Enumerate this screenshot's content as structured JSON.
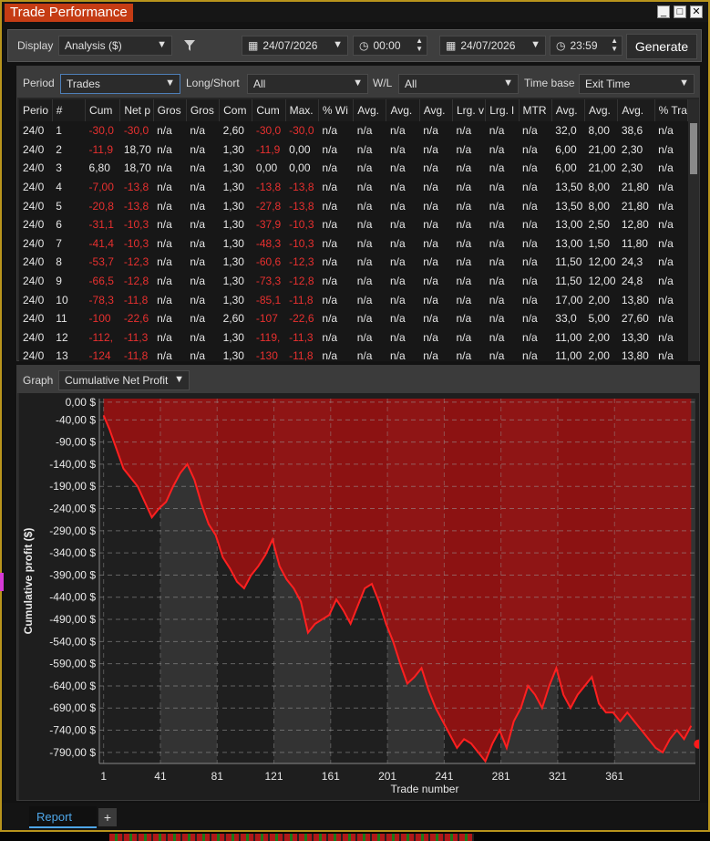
{
  "window": {
    "title": "Trade Performance",
    "controls": [
      "_",
      "□",
      "✕"
    ]
  },
  "toolbar": {
    "display_label": "Display",
    "display_value": "Analysis ($)",
    "start_date": "24/07/2026",
    "start_time": "00:00",
    "end_date": "24/07/2026",
    "end_time": "23:59",
    "generate_label": "Generate"
  },
  "filters": {
    "period_label": "Period",
    "period_value": "Trades",
    "longshort_label": "Long/Short",
    "longshort_value": "All",
    "wl_label": "W/L",
    "wl_value": "All",
    "timebase_label": "Time base",
    "timebase_value": "Exit Time"
  },
  "table": {
    "columns": [
      "Perio",
      "#",
      "Cum",
      "Net p",
      "Gros",
      "Gros",
      "Com",
      "Cum",
      "Max.",
      "% Wi",
      "Avg.",
      "Avg.",
      "Avg.",
      "Lrg. v",
      "Lrg. l",
      "MTR",
      "Avg.",
      "Avg.",
      "Avg.",
      "% Tra"
    ],
    "rows": [
      [
        "24/0",
        "1",
        "-30,0",
        "-30,0",
        "n/a",
        "n/a",
        "2,60",
        "-30,0",
        "-30,0",
        "n/a",
        "n/a",
        "n/a",
        "n/a",
        "n/a",
        "n/a",
        "n/a",
        "32,0",
        "8,00",
        "38,6",
        "n/a"
      ],
      [
        "24/0",
        "2",
        "-11,9",
        "18,70",
        "n/a",
        "n/a",
        "1,30",
        "-11,9",
        "0,00",
        "n/a",
        "n/a",
        "n/a",
        "n/a",
        "n/a",
        "n/a",
        "n/a",
        "6,00",
        "21,00",
        "2,30",
        "n/a"
      ],
      [
        "24/0",
        "3",
        "6,80",
        "18,70",
        "n/a",
        "n/a",
        "1,30",
        "0,00",
        "0,00",
        "n/a",
        "n/a",
        "n/a",
        "n/a",
        "n/a",
        "n/a",
        "n/a",
        "6,00",
        "21,00",
        "2,30",
        "n/a"
      ],
      [
        "24/0",
        "4",
        "-7,00",
        "-13,8",
        "n/a",
        "n/a",
        "1,30",
        "-13,8",
        "-13,8",
        "n/a",
        "n/a",
        "n/a",
        "n/a",
        "n/a",
        "n/a",
        "n/a",
        "13,50",
        "8,00",
        "21,80",
        "n/a"
      ],
      [
        "24/0",
        "5",
        "-20,8",
        "-13,8",
        "n/a",
        "n/a",
        "1,30",
        "-27,8",
        "-13,8",
        "n/a",
        "n/a",
        "n/a",
        "n/a",
        "n/a",
        "n/a",
        "n/a",
        "13,50",
        "8,00",
        "21,80",
        "n/a"
      ],
      [
        "24/0",
        "6",
        "-31,1",
        "-10,3",
        "n/a",
        "n/a",
        "1,30",
        "-37,9",
        "-10,3",
        "n/a",
        "n/a",
        "n/a",
        "n/a",
        "n/a",
        "n/a",
        "n/a",
        "13,00",
        "2,50",
        "12,80",
        "n/a"
      ],
      [
        "24/0",
        "7",
        "-41,4",
        "-10,3",
        "n/a",
        "n/a",
        "1,30",
        "-48,3",
        "-10,3",
        "n/a",
        "n/a",
        "n/a",
        "n/a",
        "n/a",
        "n/a",
        "n/a",
        "13,00",
        "1,50",
        "11,80",
        "n/a"
      ],
      [
        "24/0",
        "8",
        "-53,7",
        "-12,3",
        "n/a",
        "n/a",
        "1,30",
        "-60,6",
        "-12,3",
        "n/a",
        "n/a",
        "n/a",
        "n/a",
        "n/a",
        "n/a",
        "n/a",
        "11,50",
        "12,00",
        "24,3",
        "n/a"
      ],
      [
        "24/0",
        "9",
        "-66,5",
        "-12,8",
        "n/a",
        "n/a",
        "1,30",
        "-73,3",
        "-12,8",
        "n/a",
        "n/a",
        "n/a",
        "n/a",
        "n/a",
        "n/a",
        "n/a",
        "11,50",
        "12,00",
        "24,8",
        "n/a"
      ],
      [
        "24/0",
        "10",
        "-78,3",
        "-11,8",
        "n/a",
        "n/a",
        "1,30",
        "-85,1",
        "-11,8",
        "n/a",
        "n/a",
        "n/a",
        "n/a",
        "n/a",
        "n/a",
        "n/a",
        "17,00",
        "2,00",
        "13,80",
        "n/a"
      ],
      [
        "24/0",
        "11",
        "-100",
        "-22,6",
        "n/a",
        "n/a",
        "2,60",
        "-107",
        "-22,6",
        "n/a",
        "n/a",
        "n/a",
        "n/a",
        "n/a",
        "n/a",
        "n/a",
        "33,0",
        "5,00",
        "27,60",
        "n/a"
      ],
      [
        "24/0",
        "12",
        "-112,",
        "-11,3",
        "n/a",
        "n/a",
        "1,30",
        "-119,",
        "-11,3",
        "n/a",
        "n/a",
        "n/a",
        "n/a",
        "n/a",
        "n/a",
        "n/a",
        "11,00",
        "2,00",
        "13,30",
        "n/a"
      ],
      [
        "24/0",
        "13",
        "-124",
        "-11,8",
        "n/a",
        "n/a",
        "1,30",
        "-130",
        "-11,8",
        "n/a",
        "n/a",
        "n/a",
        "n/a",
        "n/a",
        "n/a",
        "n/a",
        "11,00",
        "2,00",
        "13,80",
        "n/a"
      ]
    ]
  },
  "graph": {
    "label": "Graph",
    "value": "Cumulative Net Profit"
  },
  "chart_data": {
    "type": "area",
    "title": "",
    "xlabel": "Trade number",
    "ylabel": "Cumulative profit ($)",
    "xticks": [
      1,
      41,
      81,
      121,
      161,
      201,
      241,
      281,
      321,
      361
    ],
    "ytick_labels": [
      "0,00 $",
      "-40,00 $",
      "-90,00 $",
      "-140,00 $",
      "-190,00 $",
      "-240,00 $",
      "-290,00 $",
      "-340,00 $",
      "-390,00 $",
      "-440,00 $",
      "-490,00 $",
      "-540,00 $",
      "-590,00 $",
      "-640,00 $",
      "-690,00 $",
      "-740,00 $",
      "-790,00 $"
    ],
    "ytick_values": [
      0,
      -40,
      -90,
      -140,
      -190,
      -240,
      -290,
      -340,
      -390,
      -440,
      -490,
      -540,
      -590,
      -640,
      -690,
      -740,
      -790
    ],
    "xlim": [
      -2,
      418
    ],
    "ylim": [
      -815,
      8
    ],
    "series": [
      {
        "x": [
          1,
          5,
          10,
          15,
          20,
          25,
          30,
          35,
          40,
          45,
          50,
          55,
          60,
          65,
          70,
          75,
          80,
          85,
          90,
          95,
          100,
          105,
          110,
          115,
          120,
          125,
          130,
          135,
          140,
          145,
          150,
          155,
          160,
          165,
          170,
          175,
          180,
          185,
          190,
          195,
          200,
          205,
          210,
          215,
          220,
          225,
          230,
          235,
          240,
          245,
          250,
          255,
          260,
          265,
          270,
          275,
          280,
          285,
          290,
          295,
          300,
          305,
          310,
          315,
          320,
          325,
          330,
          335,
          340,
          345,
          350,
          355,
          360,
          365,
          370,
          375,
          380,
          385,
          390,
          395,
          400,
          405,
          410,
          415
        ],
        "y": [
          -30,
          -60,
          -105,
          -150,
          -170,
          -190,
          -225,
          -260,
          -240,
          -225,
          -190,
          -160,
          -140,
          -175,
          -230,
          -275,
          -300,
          -350,
          -375,
          -405,
          -420,
          -390,
          -370,
          -345,
          -310,
          -370,
          -400,
          -420,
          -450,
          -520,
          -500,
          -490,
          -480,
          -445,
          -470,
          -500,
          -460,
          -420,
          -410,
          -450,
          -500,
          -540,
          -590,
          -635,
          -620,
          -600,
          -650,
          -690,
          -720,
          -750,
          -780,
          -760,
          -770,
          -790,
          -810,
          -770,
          -740,
          -780,
          -720,
          -690,
          -640,
          -660,
          -690,
          -640,
          -600,
          -660,
          -690,
          -660,
          -640,
          -620,
          -680,
          -700,
          -700,
          -720,
          -700,
          -720,
          -740,
          -760,
          -780,
          -790,
          -760,
          -740,
          -760,
          -730
        ]
      }
    ],
    "fill_color": "#a01010",
    "line_color": "#ff2020",
    "grid": true
  }
}
